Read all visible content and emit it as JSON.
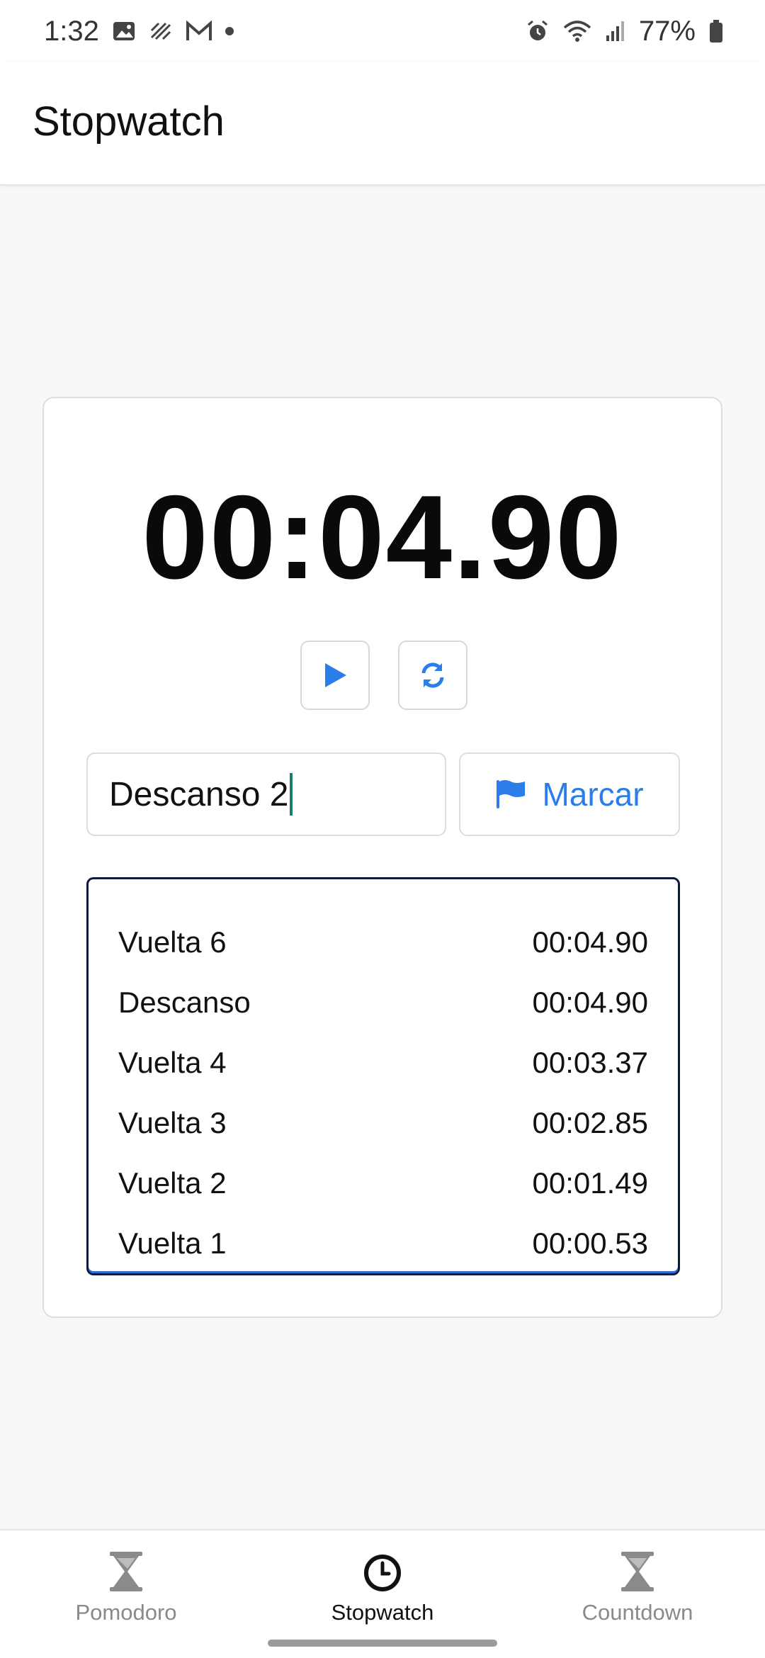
{
  "status_bar": {
    "time": "1:32",
    "battery": "77%",
    "icons": [
      "image-icon",
      "signal-sync-icon",
      "gmail-icon",
      "notification-dot",
      "alarm-icon",
      "wifi-icon",
      "cell-signal-icon",
      "battery-icon"
    ]
  },
  "app_bar": {
    "title": "Stopwatch"
  },
  "stopwatch": {
    "time": "00:04.90",
    "play_icon": "play-icon",
    "reset_icon": "refresh-icon"
  },
  "lap_input": {
    "value": "Descanso 2"
  },
  "mark_button": {
    "label": "Marcar",
    "icon": "flag-icon"
  },
  "laps": [
    {
      "name": "Vuelta 6",
      "time": "00:04.90"
    },
    {
      "name": "Descanso",
      "time": "00:04.90"
    },
    {
      "name": "Vuelta 4",
      "time": "00:03.37"
    },
    {
      "name": "Vuelta 3",
      "time": "00:02.85"
    },
    {
      "name": "Vuelta 2",
      "time": "00:01.49"
    },
    {
      "name": "Vuelta 1",
      "time": "00:00.53"
    }
  ],
  "bottom_nav": {
    "items": [
      {
        "label": "Pomodoro",
        "icon": "hourglass-icon",
        "active": false
      },
      {
        "label": "Stopwatch",
        "icon": "clock-icon",
        "active": true
      },
      {
        "label": "Countdown",
        "icon": "hourglass-icon",
        "active": false
      }
    ]
  },
  "colors": {
    "accent": "#2b7de9",
    "active_nav": "#111111",
    "inactive_nav": "#8a8a8a",
    "caret": "#1a7f6c",
    "laps_border": "#0d1b3a"
  }
}
